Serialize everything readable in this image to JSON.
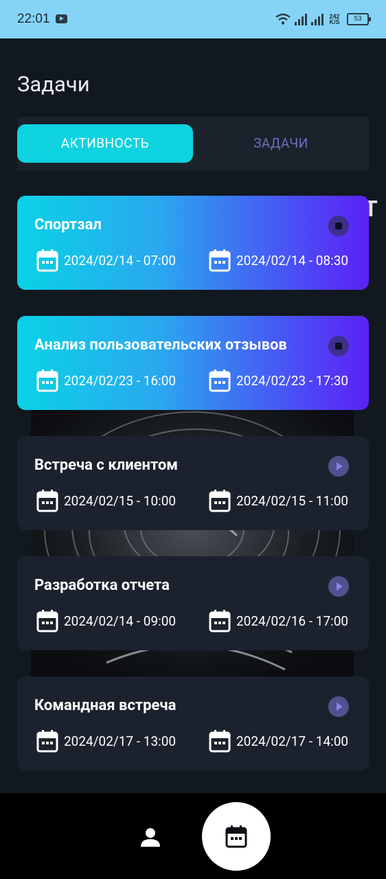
{
  "status_bar": {
    "time": "22:01",
    "network_speed_value": "242",
    "network_speed_unit": "K/S",
    "battery": "53"
  },
  "header": {
    "title": "Задачи"
  },
  "tabs": [
    {
      "label": "АКТИВНОСТЬ",
      "active": true
    },
    {
      "label": "ЗАДАЧИ",
      "active": false
    }
  ],
  "ghost_letter": "Т",
  "tasks": [
    {
      "title": "Спортзал",
      "start": "2024/02/14 - 07:00",
      "end": "2024/02/14 - 08:30",
      "state": "running"
    },
    {
      "title": "Анализ пользовательских отзывов",
      "start": "2024/02/23 - 16:00",
      "end": "2024/02/23 - 17:30",
      "state": "running"
    },
    {
      "title": "Встреча с клиентом",
      "start": "2024/02/15 - 10:00",
      "end": "2024/02/15 - 11:00",
      "state": "paused"
    },
    {
      "title": "Разработка отчета",
      "start": "2024/02/14 - 09:00",
      "end": "2024/02/16 - 17:00",
      "state": "paused"
    },
    {
      "title": "Командная встреча",
      "start": "2024/02/17 - 13:00",
      "end": "2024/02/17 - 14:00",
      "state": "paused"
    }
  ],
  "colors": {
    "accent_start": "#0ad2e6",
    "accent_end": "#5b22f5",
    "tab_active": "#0fd2e1",
    "tab_inactive_text": "#6f6fb8",
    "card_background": "#1c222d",
    "app_background": "#121820",
    "status_bar": "#85d4f8"
  },
  "bottom_nav": {
    "items": [
      {
        "icon": "person-icon"
      },
      {
        "icon": "calendar-icon",
        "selected": true
      }
    ]
  }
}
